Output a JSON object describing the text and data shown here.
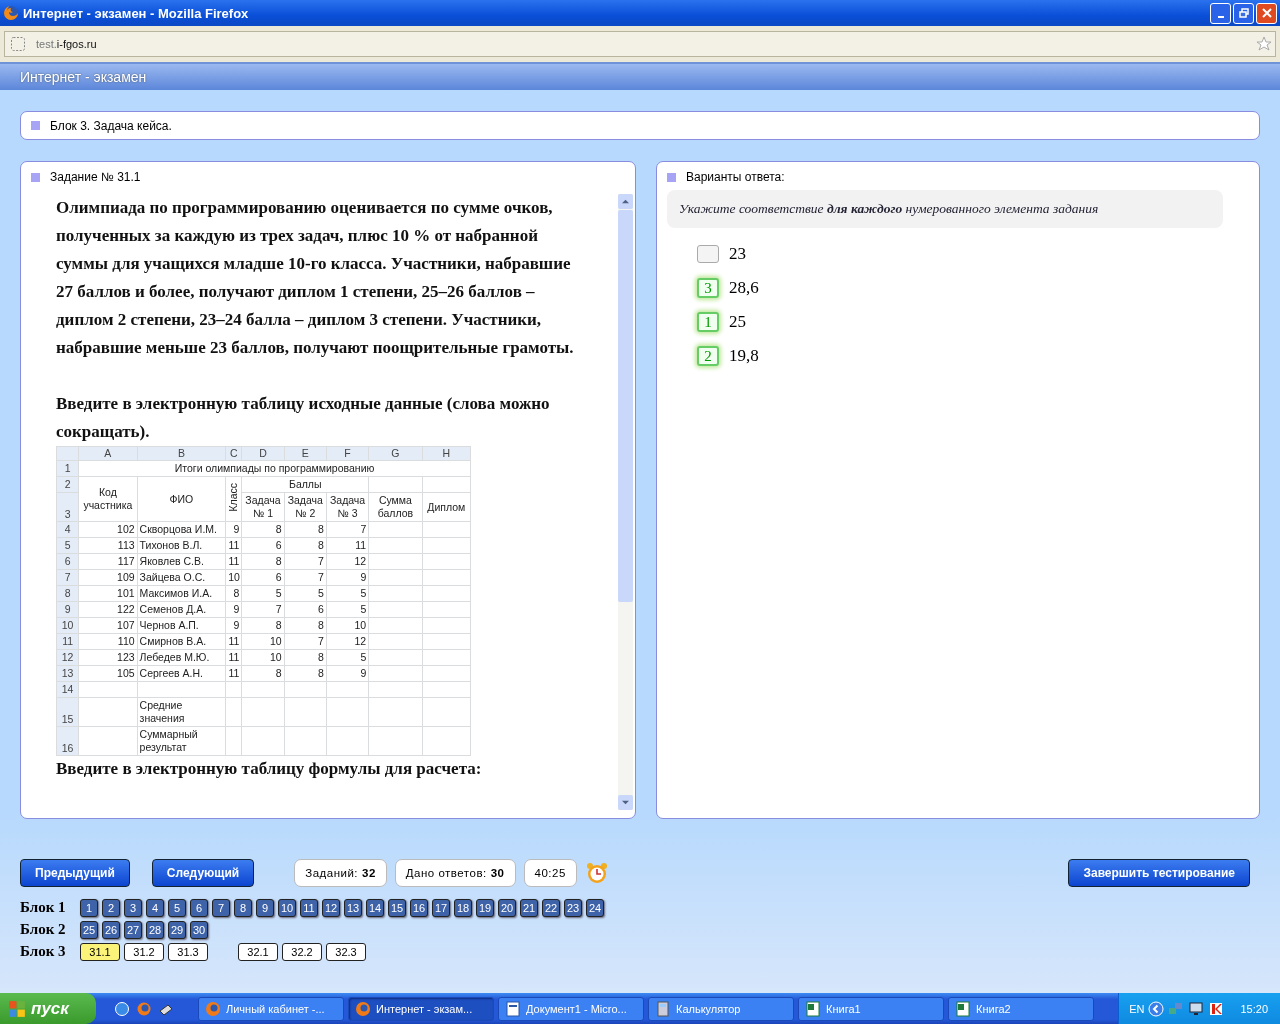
{
  "window": {
    "title": "Интернет - экзамен - Mozilla Firefox",
    "url_prefix": "test.",
    "url_domain": "i-fgos.ru"
  },
  "app_title": "Интернет - экзамен",
  "block_title": "Блок 3. Задача кейса.",
  "task": {
    "heading": "Задание № 31.1",
    "paragraphs": [
      "Олимпиада по программированию оценивается по сумме очков, полученных за каждую из трех задач, плюс 10 % от набранной суммы для учащихся младше 10-го класса. Участники, набравшие 27 баллов и более, получают диплом 1 степени, 25–26 баллов – диплом 2 степени, 23–24 балла – диплом 3 степени. Участники, набравшие меньше 23 баллов, получают поощрительные грамоты.",
      "Введите в электронную таблицу исходные данные (слова можно сокращать)."
    ],
    "sheet": {
      "columns": [
        "A",
        "B",
        "C",
        "D",
        "E",
        "F",
        "G",
        "H"
      ],
      "title_row": {
        "num": "1",
        "text": "Итоги олимпиады по программированию"
      },
      "header_nums": [
        "2",
        "3"
      ],
      "headers": {
        "code": "Код участника",
        "name": "ФИО",
        "grade": "Класс",
        "points": "Баллы",
        "tasks": [
          "Задача № 1",
          "Задача № 2",
          "Задача № 3"
        ],
        "sum": "Сумма баллов",
        "diploma": "Диплом"
      },
      "rows": [
        {
          "num": "4",
          "cells": [
            "102",
            "Скворцова И.М.",
            "9",
            "8",
            "8",
            "7"
          ]
        },
        {
          "num": "5",
          "cells": [
            "113",
            "Тихонов В.Л.",
            "11",
            "6",
            "8",
            "11"
          ]
        },
        {
          "num": "6",
          "cells": [
            "117",
            "Яковлев С.В.",
            "11",
            "8",
            "7",
            "12"
          ]
        },
        {
          "num": "7",
          "cells": [
            "109",
            "Зайцева О.С.",
            "10",
            "6",
            "7",
            "9"
          ]
        },
        {
          "num": "8",
          "cells": [
            "101",
            "Максимов И.А.",
            "8",
            "5",
            "5",
            "5"
          ]
        },
        {
          "num": "9",
          "cells": [
            "122",
            "Семенов Д.А.",
            "9",
            "7",
            "6",
            "5"
          ]
        },
        {
          "num": "10",
          "cells": [
            "107",
            "Чернов А.П.",
            "9",
            "8",
            "8",
            "10"
          ]
        },
        {
          "num": "11",
          "cells": [
            "110",
            "Смирнов В.А.",
            "11",
            "10",
            "7",
            "12"
          ]
        },
        {
          "num": "12",
          "cells": [
            "123",
            "Лебедев М.Ю.",
            "11",
            "10",
            "8",
            "5"
          ]
        },
        {
          "num": "13",
          "cells": [
            "105",
            "Сергеев А.Н.",
            "11",
            "8",
            "8",
            "9"
          ]
        }
      ],
      "blank_row": "14",
      "footer_rows": [
        {
          "num": "15",
          "label": "Средние значения"
        },
        {
          "num": "16",
          "label": "Суммарный результат"
        }
      ]
    },
    "after": "Введите в электронную таблицу формулы для расчета:"
  },
  "answers": {
    "heading": "Варианты ответа:",
    "instruction": "Укажите соответствие **для каждого** нумерованного элемента задания",
    "options": [
      {
        "value": "23"
      },
      {
        "value": "28,6",
        "number": "3"
      },
      {
        "value": "25",
        "number": "1"
      },
      {
        "value": "19,8",
        "number": "2"
      }
    ]
  },
  "nav": {
    "prev": "Предыдущий",
    "next": "Следующий",
    "tasks_label": "Заданий:",
    "tasks_value": "32",
    "answered_label": "Дано ответов:",
    "answered_value": "30",
    "timer": "40:25",
    "finish": "Завершить тестирование"
  },
  "blocks": [
    {
      "label": "Блок 1",
      "groups": [
        [
          {
            "label": "1",
            "answered": true,
            "selected": false
          },
          {
            "label": "2",
            "answered": true,
            "selected": false
          },
          {
            "label": "3",
            "answered": true,
            "selected": false
          },
          {
            "label": "4",
            "answered": true,
            "selected": false
          },
          {
            "label": "5",
            "answered": true,
            "selected": false
          },
          {
            "label": "6",
            "answered": true,
            "selected": false
          },
          {
            "label": "7",
            "answered": true,
            "selected": false
          },
          {
            "label": "8",
            "answered": true,
            "selected": false
          },
          {
            "label": "9",
            "answered": true,
            "selected": false
          },
          {
            "label": "10",
            "answered": true,
            "selected": false
          },
          {
            "label": "11",
            "answered": true,
            "selected": false
          },
          {
            "label": "12",
            "answered": true,
            "selected": false
          },
          {
            "label": "13",
            "answered": true,
            "selected": false
          },
          {
            "label": "14",
            "answered": true,
            "selected": false
          },
          {
            "label": "15",
            "answered": true,
            "selected": false
          },
          {
            "label": "16",
            "answered": true,
            "selected": false
          },
          {
            "label": "17",
            "answered": true,
            "selected": false
          },
          {
            "label": "18",
            "answered": true,
            "selected": false
          },
          {
            "label": "19",
            "answered": true,
            "selected": false
          },
          {
            "label": "20",
            "answered": true,
            "selected": false
          },
          {
            "label": "21",
            "answered": true,
            "selected": false
          },
          {
            "label": "22",
            "answered": true,
            "selected": false
          },
          {
            "label": "23",
            "answered": true,
            "selected": false
          },
          {
            "label": "24",
            "answered": true,
            "selected": false
          }
        ]
      ]
    },
    {
      "label": "Блок 2",
      "groups": [
        [
          {
            "label": "25",
            "answered": true,
            "selected": false
          },
          {
            "label": "26",
            "answered": true,
            "selected": false
          },
          {
            "label": "27",
            "answered": true,
            "selected": false
          },
          {
            "label": "28",
            "answered": true,
            "selected": false
          },
          {
            "label": "29",
            "answered": true,
            "selected": false
          },
          {
            "label": "30",
            "answered": true,
            "selected": false
          }
        ]
      ]
    },
    {
      "label": "Блок 3",
      "groups": [
        [
          {
            "label": "31.1",
            "answered": false,
            "selected": true
          },
          {
            "label": "31.2",
            "answered": false,
            "selected": false
          },
          {
            "label": "31.3",
            "answered": false,
            "selected": false
          }
        ],
        [
          {
            "label": "32.1",
            "answered": false,
            "selected": false
          },
          {
            "label": "32.2",
            "answered": false,
            "selected": false
          },
          {
            "label": "32.3",
            "answered": false,
            "selected": false
          }
        ]
      ]
    }
  ],
  "taskbar": {
    "start": "пуск",
    "tasks": [
      {
        "label": "Личный кабинет -...",
        "kind": "browser",
        "selected": false
      },
      {
        "label": "Интернет - экзам...",
        "kind": "browser",
        "selected": true
      },
      {
        "label": "Документ1 - Micro...",
        "kind": "document",
        "selected": false
      },
      {
        "label": "Калькулятор",
        "kind": "calculator",
        "selected": false
      },
      {
        "label": "Книга1",
        "kind": "spreadsheet",
        "selected": false
      },
      {
        "label": "Книга2",
        "kind": "spreadsheet",
        "selected": false
      }
    ],
    "lang": "EN",
    "time": "15:20"
  }
}
